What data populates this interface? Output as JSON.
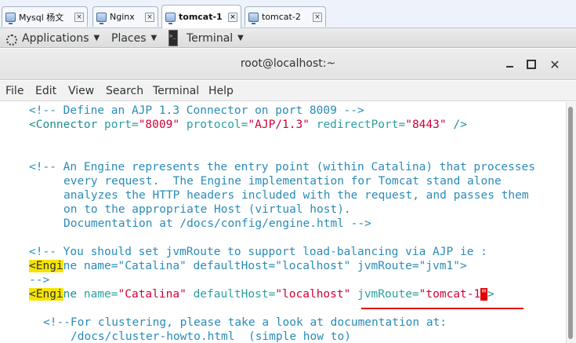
{
  "vm_tabs": [
    {
      "label": "Mysql 杨文"
    },
    {
      "label": "Nginx"
    },
    {
      "label": "tomcat-1",
      "active": true
    },
    {
      "label": "tomcat-2"
    }
  ],
  "topbar": {
    "applications": "Applications",
    "places": "Places",
    "terminal": "Terminal"
  },
  "window": {
    "title": "root@localhost:~"
  },
  "menubar": [
    "File",
    "Edit",
    "View",
    "Search",
    "Terminal",
    "Help"
  ],
  "terminal": {
    "line1": "<!-- Define an AJP 1.3 Connector on port 8009 -->",
    "line2": {
      "open": "<Connector",
      "a1": "port=",
      "v1": "\"8009\"",
      "a2": "protocol=",
      "v2": "\"AJP/1.3\"",
      "a3": "redirectPort=",
      "v3": "\"8443\"",
      "close": "/>"
    },
    "line3": "<!-- An Engine represents the entry point (within Catalina) that processes",
    "line4": "every request.  The Engine implementation for Tomcat stand alone",
    "line5": "analyzes the HTTP headers included with the request, and passes them",
    "line6": "on to the appropriate Host (virtual host).",
    "line7": "Documentation at /docs/config/engine.html -->",
    "line8": "<!-- You should set jvmRoute to support load-balancing via AJP ie :",
    "line9": {
      "hl": "<Engi",
      "rest": "ne name=\"Catalina\" defaultHost=\"localhost\" jvmRoute=\"jvm1\">"
    },
    "line10": "-->",
    "line11": {
      "hl": "<Engi",
      "ne": "ne",
      "a1": "name=",
      "v1": "\"Catalina\"",
      "a2": "defaultHost=",
      "v2": "\"localhost\"",
      "a3": "jvmRoute=",
      "v3": "\"tomcat-1",
      "cursor": "\"",
      "close": ">"
    },
    "line12": "<!--For clustering, please take a look at documentation at:",
    "line13": "/docs/cluster-howto.html  (simple how to)"
  },
  "colors": {
    "comment": "#2a8bb8",
    "tag": "#1f8e8e",
    "string": "#d0003a",
    "highlight": "#f5e400",
    "cursor": "#e00000",
    "annotation": "#e3001b"
  }
}
